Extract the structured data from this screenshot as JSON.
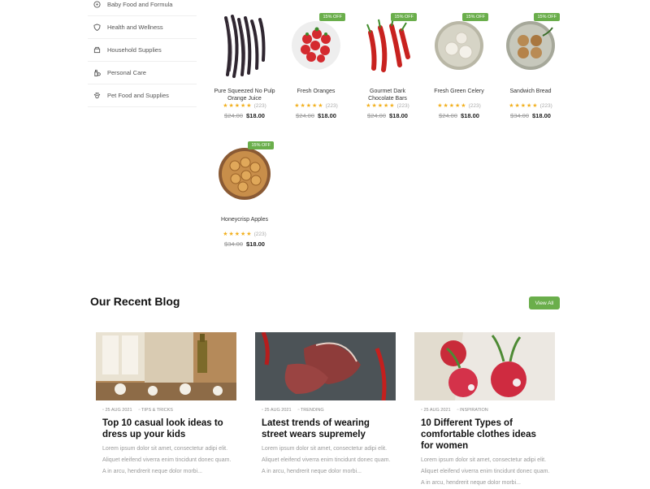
{
  "sidebar": {
    "items": [
      {
        "label": "Baby Food and Formula",
        "icon": "baby-icon"
      },
      {
        "label": "Health and Wellness",
        "icon": "shield-icon"
      },
      {
        "label": "Household Supplies",
        "icon": "basket-icon"
      },
      {
        "label": "Personal Care",
        "icon": "bottle-icon"
      },
      {
        "label": "Pet Food and Supplies",
        "icon": "paw-icon"
      }
    ]
  },
  "products": [
    {
      "name": "Pure Squeezed No Pulp Orange Juice",
      "rating": "★★★★★",
      "count": "(223)",
      "old_price": "$24.00",
      "price": "$18.00",
      "badge": ""
    },
    {
      "name": "Fresh Oranges",
      "rating": "★★★★★",
      "count": "(223)",
      "old_price": "$24.00",
      "price": "$18.00",
      "badge": "15% OFF"
    },
    {
      "name": "Gourmet Dark Chocolate Bars",
      "rating": "★★★★★",
      "count": "(223)",
      "old_price": "$24.00",
      "price": "$18.00",
      "badge": "15% OFF"
    },
    {
      "name": "Fresh Green Celery",
      "rating": "★★★★★",
      "count": "(223)",
      "old_price": "$24.00",
      "price": "$18.00",
      "badge": "15% OFF"
    },
    {
      "name": "Sandwich Bread",
      "rating": "★★★★★",
      "count": "(223)",
      "old_price": "$34.00",
      "price": "$18.00",
      "badge": "15% OFF"
    },
    {
      "name": "Honeycrisp Apples",
      "rating": "★★★★★",
      "count": "(223)",
      "old_price": "$34.00",
      "price": "$18.00",
      "badge": "15% OFF"
    }
  ],
  "blog": {
    "title": "Our Recent Blog",
    "view_all": "View All",
    "posts": [
      {
        "date": "25 AUG 2021",
        "tag": "TIPS & TRICKS",
        "title": "Top 10 casual look ideas to dress up your kids",
        "excerpt": "Lorem ipsum dolor sit amet, consectetur adipi elit. Aliquet eleifend viverra enim tincidunt donec quam. A in arcu, hendrerit neque dolor morbi..."
      },
      {
        "date": "25 AUG 2021",
        "tag": "TRENDING",
        "title": "Latest trends of wearing street wears supremely",
        "excerpt": "Lorem ipsum dolor sit amet, consectetur adipi elit. Aliquet eleifend viverra enim tincidunt donec quam. A in arcu, hendrerit neque dolor morbi..."
      },
      {
        "date": "25 AUG 2021",
        "tag": "INSPIRATION",
        "title": "10 Different Types of comfortable clothes ideas for women",
        "excerpt": "Lorem ipsum dolor sit amet, consectetur adipi elit. Aliquet eleifend viverra enim tincidunt donec quam. A in arcu, hendrerit neque dolor morbi..."
      }
    ]
  },
  "colors": {
    "accent": "#6aae4b",
    "star": "#f2b01e"
  }
}
